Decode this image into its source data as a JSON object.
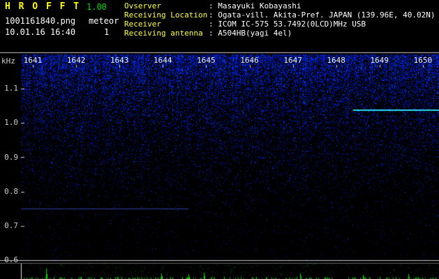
{
  "header": {
    "title": "H R O F F T",
    "version": "1.00",
    "file_name": "1001161840.png",
    "mode": "meteor",
    "count": "1",
    "datetime": "10.01.16 16:40"
  },
  "info": [
    {
      "label": "Ovserver",
      "value": ": Masayuki Kobayashi"
    },
    {
      "label": "Receiving Location",
      "value": ": Ogata-vill. Akita-Pref. JAPAN (139.96E, 40.02N)"
    },
    {
      "label": "Receiver",
      "value": ": ICOM IC-575 53.7492(0LCD)MHz USB"
    },
    {
      "label": "Receiving antenna",
      "value": ": A504HB(yagi 4el)"
    }
  ],
  "chart_data": {
    "type": "heatmap",
    "description": "Radio meteor observation spectrogram (10-minute waterfall); blue noise background denser toward higher frequency, amplitude strip at bottom with green spikes",
    "x_ticks": [
      "1641",
      "1642",
      "1643",
      "1644",
      "1645",
      "1646",
      "1647",
      "1648",
      "1649",
      "1650"
    ],
    "x_unit": "time HHMM",
    "ylabel": "kHz",
    "y_ticks": [
      "1.1",
      "1.0",
      "0.9",
      "0.8",
      "0.7",
      "0.6"
    ],
    "y_range_khz": [
      0.6,
      1.2
    ],
    "grid": false,
    "features": [
      {
        "name": "carrier-line",
        "freq_khz": 1.04,
        "x_start_frac": 0.795,
        "x_end_frac": 1.0,
        "color": "#30e8ff",
        "thickness": 2,
        "alpha": 0.95
      },
      {
        "name": "faint-signal-trace",
        "freq_khz": 0.75,
        "x_start_frac": 0.0,
        "x_end_frac": 0.4,
        "color": "#3a64ff",
        "thickness": 1,
        "alpha": 0.65
      }
    ],
    "amplitude_spikes": [
      {
        "x_frac": 0.06,
        "height": 15
      },
      {
        "x_frac": 0.335,
        "height": 8
      },
      {
        "x_frac": 0.4,
        "height": 7
      },
      {
        "x_frac": 0.437,
        "height": 9
      },
      {
        "x_frac": 0.668,
        "height": 8
      },
      {
        "x_frac": 0.818,
        "height": 6
      },
      {
        "x_frac": 0.927,
        "height": 7
      }
    ]
  },
  "colors": {
    "background": "#000000",
    "title": "#ffff00",
    "version": "#00dd00",
    "header_text": "#ffffff",
    "info_label": "#ffff44",
    "info_value": "#ffffff",
    "axis_text": "#cccccc",
    "time_text": "#f0f0f0",
    "noise_blue": "#0000c8",
    "spike_green": "#00e000",
    "separator": "#c8c8c8"
  }
}
